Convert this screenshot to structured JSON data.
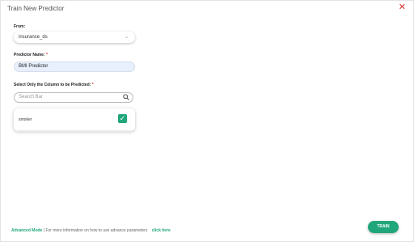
{
  "dialog": {
    "title": "Train New Predictor",
    "close_icon": "close-icon"
  },
  "form": {
    "from_label": "From:",
    "from_value": "insurance_ds",
    "predictor_name_label": "Predictor Name:",
    "required_mark": "*",
    "predictor_name_value": "BMI Predictor",
    "column_label": "Select Only the Column to be Predicted:",
    "search_placeholder": "Search Bar",
    "columns": [
      {
        "name": "smoker",
        "checked": true
      }
    ]
  },
  "footer": {
    "advanced_mode": "Advanced Mode",
    "separator": "|",
    "info_text": "For more information on how to use advance parameters",
    "link_text": "click here"
  },
  "actions": {
    "train_label": "TRAIN"
  },
  "colors": {
    "accent": "#1fa67a",
    "close": "#d9342b",
    "input_bg": "#e8f0fe"
  }
}
